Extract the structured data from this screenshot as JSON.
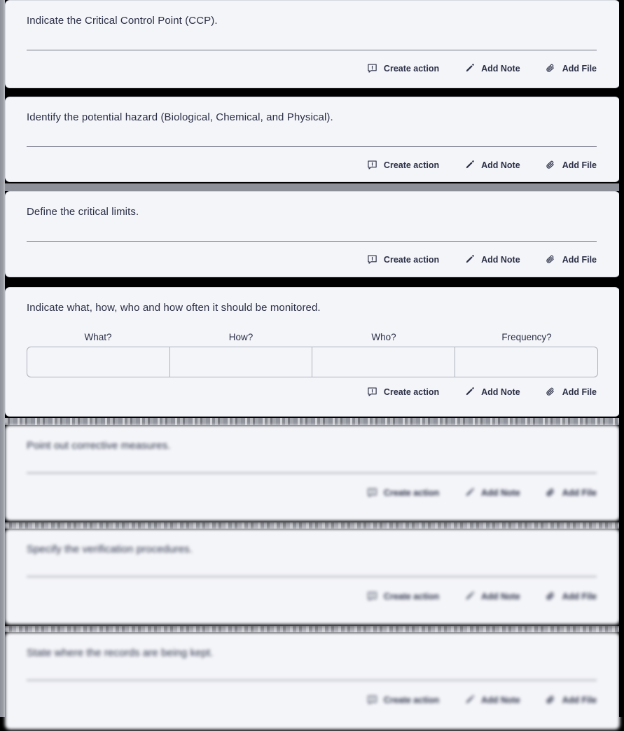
{
  "page": {
    "background_color": "#000000",
    "card_background": "#f4f5f9",
    "card_border_color": "#d6d8e0",
    "text_color": "#2b2f46",
    "rule_color": "#6f7381",
    "table_border_color": "#aeb1bc"
  },
  "actions": {
    "create_action": {
      "label": "Create action",
      "icon": "comment-alert-icon"
    },
    "add_note": {
      "label": "Add Note",
      "icon": "pencil-icon"
    },
    "add_file": {
      "label": "Add File",
      "icon": "paperclip-icon"
    }
  },
  "cards": [
    {
      "id": "ccp",
      "question": "Indicate the Critical Control Point (CCP).",
      "answer_value": "",
      "input_type": "underline"
    },
    {
      "id": "hazard",
      "question": "Identify the potential hazard (Biological, Chemical, and Physical).",
      "answer_value": "",
      "input_type": "underline"
    },
    {
      "id": "critical-limits",
      "question": "Define the critical limits.",
      "answer_value": "",
      "input_type": "underline"
    },
    {
      "id": "monitoring",
      "question": "Indicate what, how, who and how often it should be monitored.",
      "input_type": "table",
      "table": {
        "columns": [
          "What?",
          "How?",
          "Who?",
          "Frequency?"
        ],
        "rows": [
          [
            "",
            "",
            "",
            ""
          ]
        ]
      }
    },
    {
      "id": "corrective-measures",
      "question": "Point out corrective measures.",
      "answer_value": "",
      "input_type": "underline",
      "blurred": true
    },
    {
      "id": "verification",
      "question": "Specify the verification procedures.",
      "answer_value": "",
      "input_type": "underline",
      "blurred": true
    },
    {
      "id": "records",
      "question": "State where the records are being kept.",
      "answer_value": "",
      "input_type": "underline",
      "blurred": true
    }
  ]
}
